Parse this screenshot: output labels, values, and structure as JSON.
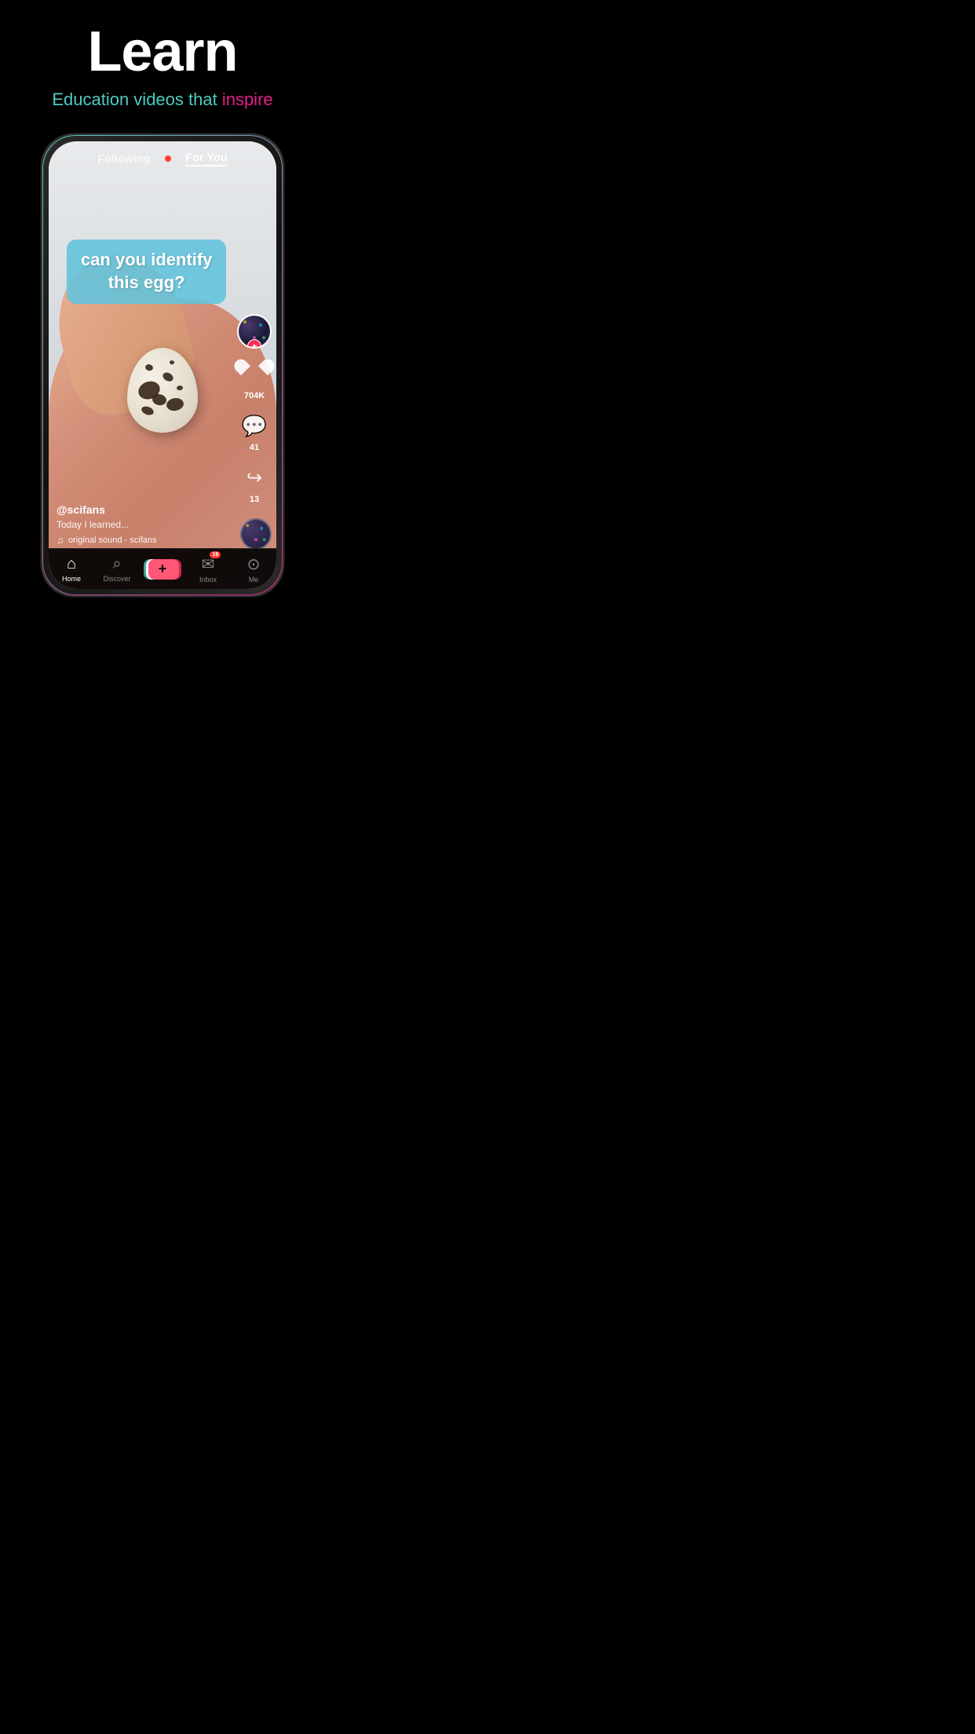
{
  "header": {
    "title": "Learn",
    "subtitle_start": "Education videos that ",
    "subtitle_highlight": "inspire"
  },
  "tiktok_ui": {
    "nav_following": "Following",
    "nav_for_you": "For You",
    "video_text_line1": "can you identify",
    "video_text_line2": "this egg?",
    "username": "@scifans",
    "caption": "Today I learned...",
    "music": "original sound - scifans",
    "likes_count": "704K",
    "comments_count": "41",
    "shares_count": "13",
    "inbox_badge": "19"
  },
  "bottom_nav": {
    "home_label": "Home",
    "discover_label": "Discover",
    "inbox_label": "Inbox",
    "me_label": "Me",
    "plus_label": "+"
  },
  "colors": {
    "teal": "#4ecdc4",
    "pink": "#e91e8c",
    "red": "#ff2d55",
    "white": "#ffffff",
    "black": "#000000"
  }
}
